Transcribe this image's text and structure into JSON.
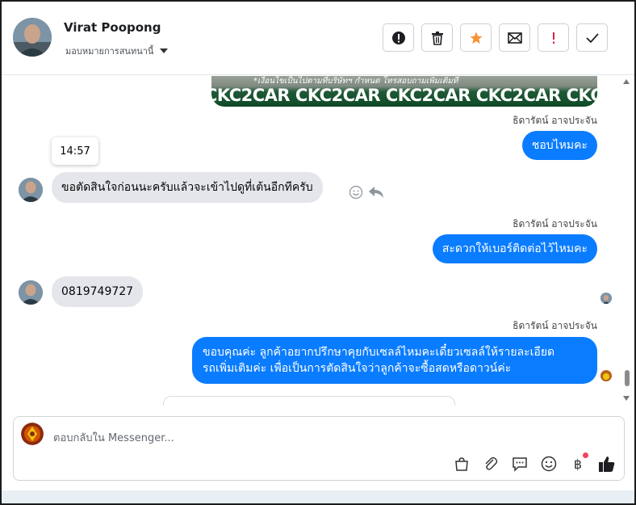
{
  "header": {
    "contact_name": "Virat Poopong",
    "assign_label": "มอบหมายการสนทนานี้",
    "actions": [
      {
        "name": "report-button",
        "icon": "exclamation-circle-icon"
      },
      {
        "name": "delete-button",
        "icon": "trash-icon"
      },
      {
        "name": "star-button",
        "icon": "star-icon",
        "color": "#f7923a"
      },
      {
        "name": "mail-button",
        "icon": "envelope-icon"
      },
      {
        "name": "mark-important-button",
        "icon": "exclamation-icon",
        "color": "#e41e3f"
      },
      {
        "name": "mark-done-button",
        "icon": "checkmark-icon"
      }
    ]
  },
  "conversation": {
    "image_caption": "*เงื่อนไขเป็นไปตามที่บริษัทฯ กำหนด โทรสอบถามเพิ่มเติมที่",
    "image_brand": "CKC2CAR CKC2CAR CKC2CAR CKC2CAR CKC2",
    "timestamp_tooltip": "14:57",
    "messages": [
      {
        "dir": "out",
        "sender": "ธิดารัตน์ อาจประจัน",
        "text": "ชอบไหมคะ"
      },
      {
        "dir": "in",
        "text": "ขอตัดสินใจก่อนนะครับแล้วจะเข้าไปดูที่เต้นอีกทีครับ"
      },
      {
        "dir": "out",
        "sender": "ธิดารัตน์ อาจประจัน",
        "text": "สะดวกให้เบอร์ติดต่อไว้ไหมคะ"
      },
      {
        "dir": "in",
        "text": "0819749727"
      },
      {
        "dir": "out",
        "sender": "ธิดารัตน์ อาจประจัน",
        "text_line1": "ขอบคุณค่ะ ลูกค้าอยากปรึกษาคุยกับเซลล์ไหมคะเดี๋ยวเซลล์ให้รายละเอียด",
        "text_line2": "รถเพิ่มเติมค่ะ เพื่อเป็นการตัดสินใจว่าลูกค้าจะซื้อสดหรือดาวน์ค่ะ"
      }
    ]
  },
  "composer": {
    "placeholder": "ตอบกลับใน Messenger...",
    "baht_symbol": "฿",
    "tools": [
      "shopping-bag-icon",
      "paperclip-icon",
      "saved-reply-icon",
      "emoji-icon",
      "baht-icon",
      "thumbs-up-icon"
    ]
  },
  "colors": {
    "outgoing_bubble": "#0a7cff",
    "incoming_bubble": "#e4e6eb",
    "star": "#f7923a",
    "important": "#e41e3f"
  }
}
